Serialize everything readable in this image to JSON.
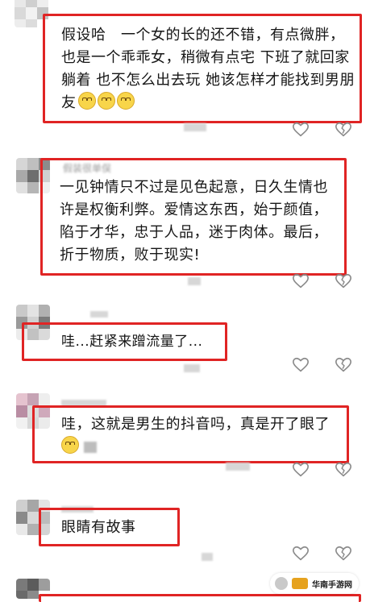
{
  "colors": {
    "highlight_red": "#e02424",
    "icon_gray": "#8a8a8a"
  },
  "comments": [
    {
      "text": "假设哈　一个女的长的还不错，有点微胖，也是一个乖乖女，稍微有点宅 下班了就回家躺着 也不怎么出去玩 她该怎样才能找到男朋友"
    },
    {
      "username": "假装很单俣",
      "text": "一见钟情只不过是见色起意，日久生情也许是权衡利弊。爱情这东西，始于颜值，陷于才华，忠于人品，迷于肉体。最后，折于物质，败于现实!"
    },
    {
      "text": "哇...赶紧来蹭流量了..."
    },
    {
      "text": "哇，这就是男生的抖音吗，真是开了眼了"
    },
    {
      "text": "眼睛有故事"
    }
  ],
  "icons": {
    "like": "heart-outline-icon",
    "dislike": "broken-heart-icon",
    "emoji": "grinning-face-emoji"
  },
  "watermark": {
    "text": "华南手游网"
  }
}
